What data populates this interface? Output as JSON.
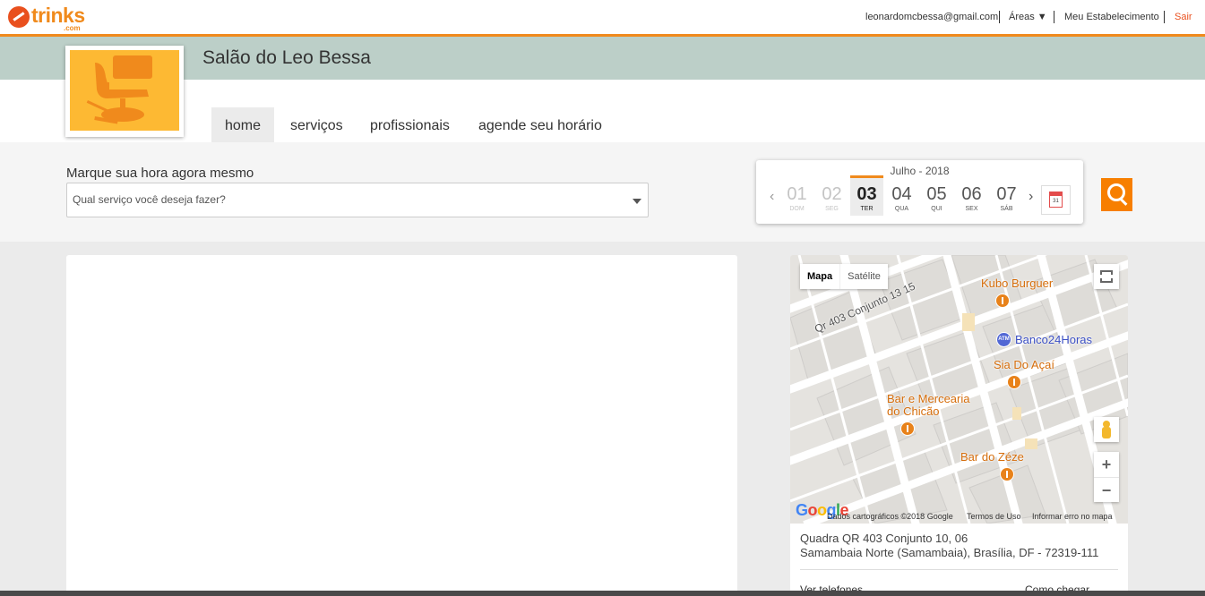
{
  "header": {
    "logo_text": "trinks",
    "logo_sub": ".com",
    "email": "leonardomcbessa@gmail.com",
    "areas_label": "Áreas ▼",
    "establishment_label": "Meu Estabelecimento",
    "logout_label": "Sair",
    "accent_color": "#f08a1c"
  },
  "salon": {
    "name": "Salão do Leo Bessa"
  },
  "nav": {
    "tabs": [
      {
        "label": "home",
        "active": true
      },
      {
        "label": "serviços"
      },
      {
        "label": "profissionais"
      },
      {
        "label": "agende seu horário"
      }
    ]
  },
  "booking": {
    "label": "Marque sua hora agora mesmo",
    "service_placeholder": "Qual serviço você deseja fazer?"
  },
  "calendar": {
    "month": "Julho - 2018",
    "prev": "‹",
    "next": "›",
    "days": [
      {
        "num": "01",
        "dow": "DOM",
        "state": "past"
      },
      {
        "num": "02",
        "dow": "SEG",
        "state": "past"
      },
      {
        "num": "03",
        "dow": "TER",
        "state": "selected"
      },
      {
        "num": "04",
        "dow": "QUA",
        "state": "normal"
      },
      {
        "num": "05",
        "dow": "QUI",
        "state": "normal"
      },
      {
        "num": "06",
        "dow": "SEX",
        "state": "normal"
      },
      {
        "num": "07",
        "dow": "SÁB",
        "state": "normal"
      }
    ],
    "calendar_icon_day": "31"
  },
  "search": {
    "icon": "search-icon",
    "color": "#f77f00"
  },
  "map": {
    "type_buttons": [
      "Mapa",
      "Satélite"
    ],
    "street_label": "Qr 403 Conjunto 13 15",
    "pois": [
      {
        "label": "Kubo Burguer",
        "type": "restaurant"
      },
      {
        "label": "Banco24Horas",
        "type": "atm"
      },
      {
        "label": "Sia Do Açaí",
        "type": "restaurant"
      },
      {
        "label": "Bar e Mercearia",
        "type": "restaurant"
      },
      {
        "label": "do Chicão",
        "type": "restaurant"
      },
      {
        "label": "Bar do Zéze",
        "type": "restaurant"
      }
    ],
    "zoom_in": "+",
    "zoom_out": "−",
    "google_logo": "Google",
    "attribution": "Dados cartográficos ©2018 Google",
    "terms": "Termos de Uso",
    "report": "Informar erro no mapa"
  },
  "address": {
    "line1": "Quadra QR 403 Conjunto 10, 06",
    "line2": "Samambaia Norte (Samambaia), Brasília, DF - 72319-111",
    "phones_label": "Ver telefones",
    "directions_label": "Como chegar"
  }
}
